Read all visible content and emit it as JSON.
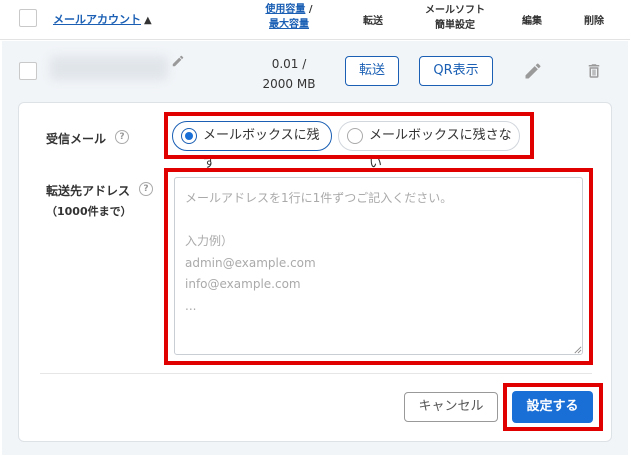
{
  "header": {
    "account_label": "メールアカウント",
    "sort_indicator": "▲",
    "usage_line1": "使用容量",
    "usage_slash": " /",
    "usage_line2": "最大容量",
    "forward_label": "転送",
    "mailsoft_line1": "メールソフト",
    "mailsoft_line2": "簡単設定",
    "edit_label": "編集",
    "delete_label": "削除"
  },
  "row": {
    "usage_used": "0.01 /",
    "usage_max": "2000 MB",
    "forward_button": "転送",
    "qr_button": "QR表示",
    "icons": {
      "edit": "pencil-icon",
      "delete": "trash-icon"
    }
  },
  "form": {
    "receive_label": "受信メール",
    "receive_options": [
      {
        "label": "メールボックスに残す",
        "selected": true
      },
      {
        "label": "メールボックスに残さない",
        "selected": false
      }
    ],
    "forward_label": "転送先アドレス",
    "forward_sublabel": "（1000件まで）",
    "forward_placeholder": "メールアドレスを1行に1件ずつご記入ください。\n\n入力例）\nadmin@example.com\ninfo@example.com\n...",
    "help_glyph": "?",
    "cancel_button": "キャンセル",
    "submit_button": "設定する"
  },
  "colors": {
    "accent": "#1a6fd6",
    "link": "#1a5fb4",
    "highlight": "#e00000",
    "panel_bg": "#f2f5f8"
  }
}
